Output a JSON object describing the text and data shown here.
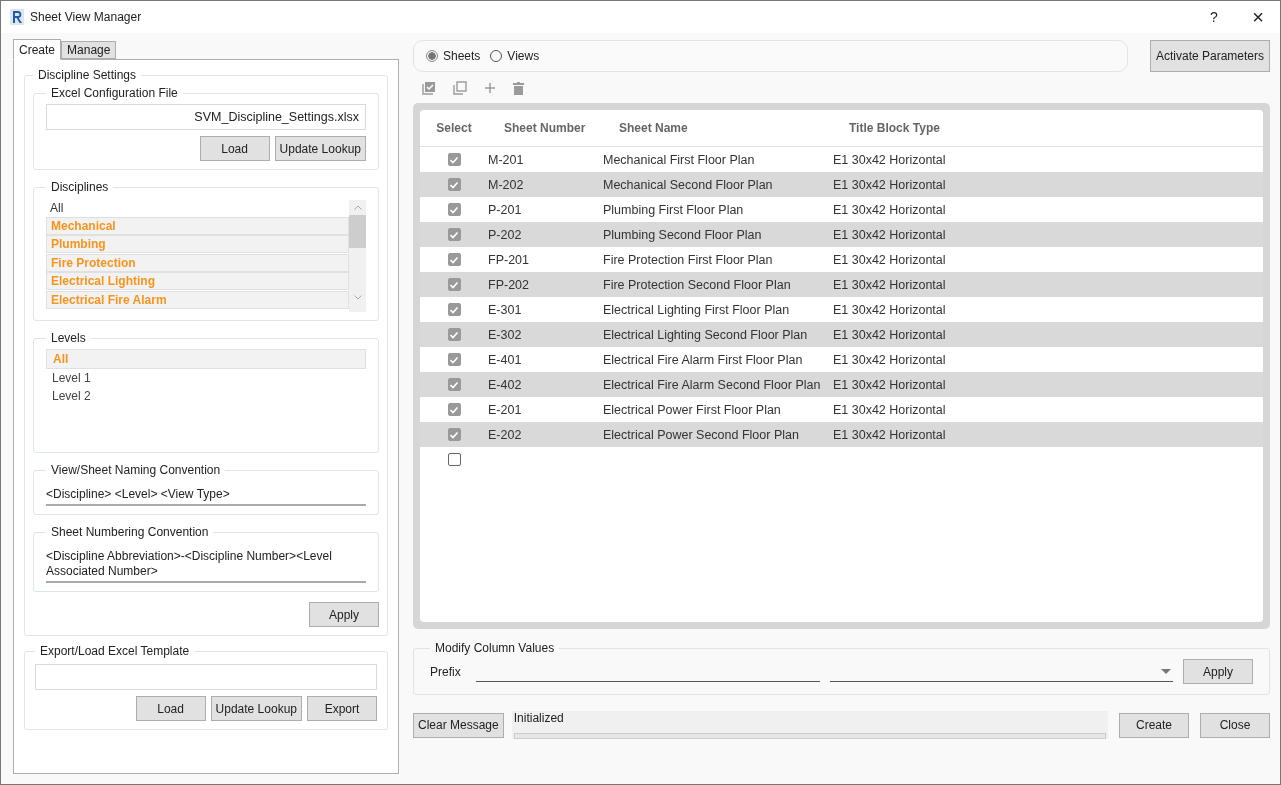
{
  "window": {
    "title": "Sheet View Manager",
    "help": "?",
    "close": "×"
  },
  "tabs": [
    {
      "label": "Create",
      "selected": true
    },
    {
      "label": "Manage",
      "selected": false
    }
  ],
  "discipline_settings": {
    "title": "Discipline Settings",
    "excel_config": {
      "title": "Excel Configuration File",
      "value": "SVM_Discipline_Settings.xlsx",
      "buttons": [
        "Load",
        "Update Lookup"
      ]
    },
    "disciplines": {
      "title": "Disciplines",
      "items": [
        {
          "label": "All",
          "selected": false
        },
        {
          "label": "Mechanical",
          "selected": true
        },
        {
          "label": "Plumbing",
          "selected": true
        },
        {
          "label": "Fire Protection",
          "selected": true
        },
        {
          "label": "Electrical Lighting",
          "selected": true
        },
        {
          "label": "Electrical Fire Alarm",
          "selected": true
        }
      ]
    },
    "levels": {
      "title": "Levels",
      "items": [
        {
          "label": "All",
          "selected": true
        },
        {
          "label": "Level 1",
          "selected": false
        },
        {
          "label": "Level 2",
          "selected": false
        }
      ]
    },
    "naming": {
      "title": "View/Sheet Naming Convention",
      "value": "<Discipline> <Level> <View Type>"
    },
    "numbering": {
      "title": "Sheet Numbering Convention",
      "value": "<Discipline Abbreviation>-<Discipline Number><Level Associated Number>"
    },
    "apply": "Apply"
  },
  "export_template": {
    "title": "Export/Load Excel Template",
    "buttons": [
      "Load",
      "Update Lookup",
      "Export"
    ]
  },
  "mode": [
    {
      "label": "Sheets",
      "selected": true
    },
    {
      "label": "Views",
      "selected": false
    }
  ],
  "activate_button": "Activate Parameters",
  "table": {
    "columns": [
      "Select",
      "Sheet Number",
      "Sheet Name",
      "Title Block Type"
    ],
    "rows": [
      {
        "checked": true,
        "number": "M-201",
        "name": "Mechanical First Floor Plan",
        "title_block": "E1 30x42 Horizontal"
      },
      {
        "checked": true,
        "number": "M-202",
        "name": "Mechanical Second Floor Plan",
        "title_block": "E1 30x42 Horizontal"
      },
      {
        "checked": true,
        "number": "P-201",
        "name": "Plumbing First Floor Plan",
        "title_block": "E1 30x42 Horizontal"
      },
      {
        "checked": true,
        "number": "P-202",
        "name": "Plumbing Second Floor Plan",
        "title_block": "E1 30x42 Horizontal"
      },
      {
        "checked": true,
        "number": "FP-201",
        "name": "Fire Protection First Floor Plan",
        "title_block": "E1 30x42 Horizontal"
      },
      {
        "checked": true,
        "number": "FP-202",
        "name": "Fire Protection Second Floor Plan",
        "title_block": "E1 30x42 Horizontal"
      },
      {
        "checked": true,
        "number": "E-301",
        "name": "Electrical Lighting First Floor Plan",
        "title_block": "E1 30x42 Horizontal"
      },
      {
        "checked": true,
        "number": "E-302",
        "name": "Electrical Lighting Second Floor Plan",
        "title_block": "E1 30x42 Horizontal"
      },
      {
        "checked": true,
        "number": "E-401",
        "name": "Electrical Fire Alarm First Floor Plan",
        "title_block": "E1 30x42 Horizontal"
      },
      {
        "checked": true,
        "number": "E-402",
        "name": "Electrical Fire Alarm Second Floor Plan",
        "title_block": "E1 30x42 Horizontal"
      },
      {
        "checked": true,
        "number": "E-201",
        "name": "Electrical Power First Floor Plan",
        "title_block": "E1 30x42 Horizontal"
      },
      {
        "checked": true,
        "number": "E-202",
        "name": "Electrical Power Second Floor Plan",
        "title_block": "E1 30x42 Horizontal"
      },
      {
        "checked": false
      }
    ]
  },
  "modify": {
    "title": "Modify Column Values",
    "label": "Prefix",
    "apply": "Apply"
  },
  "status": {
    "clear_button": "Clear Message",
    "message": "Initialized",
    "progress": {
      "level": 0
    }
  },
  "buttons": [
    "Create",
    "Close"
  ]
}
